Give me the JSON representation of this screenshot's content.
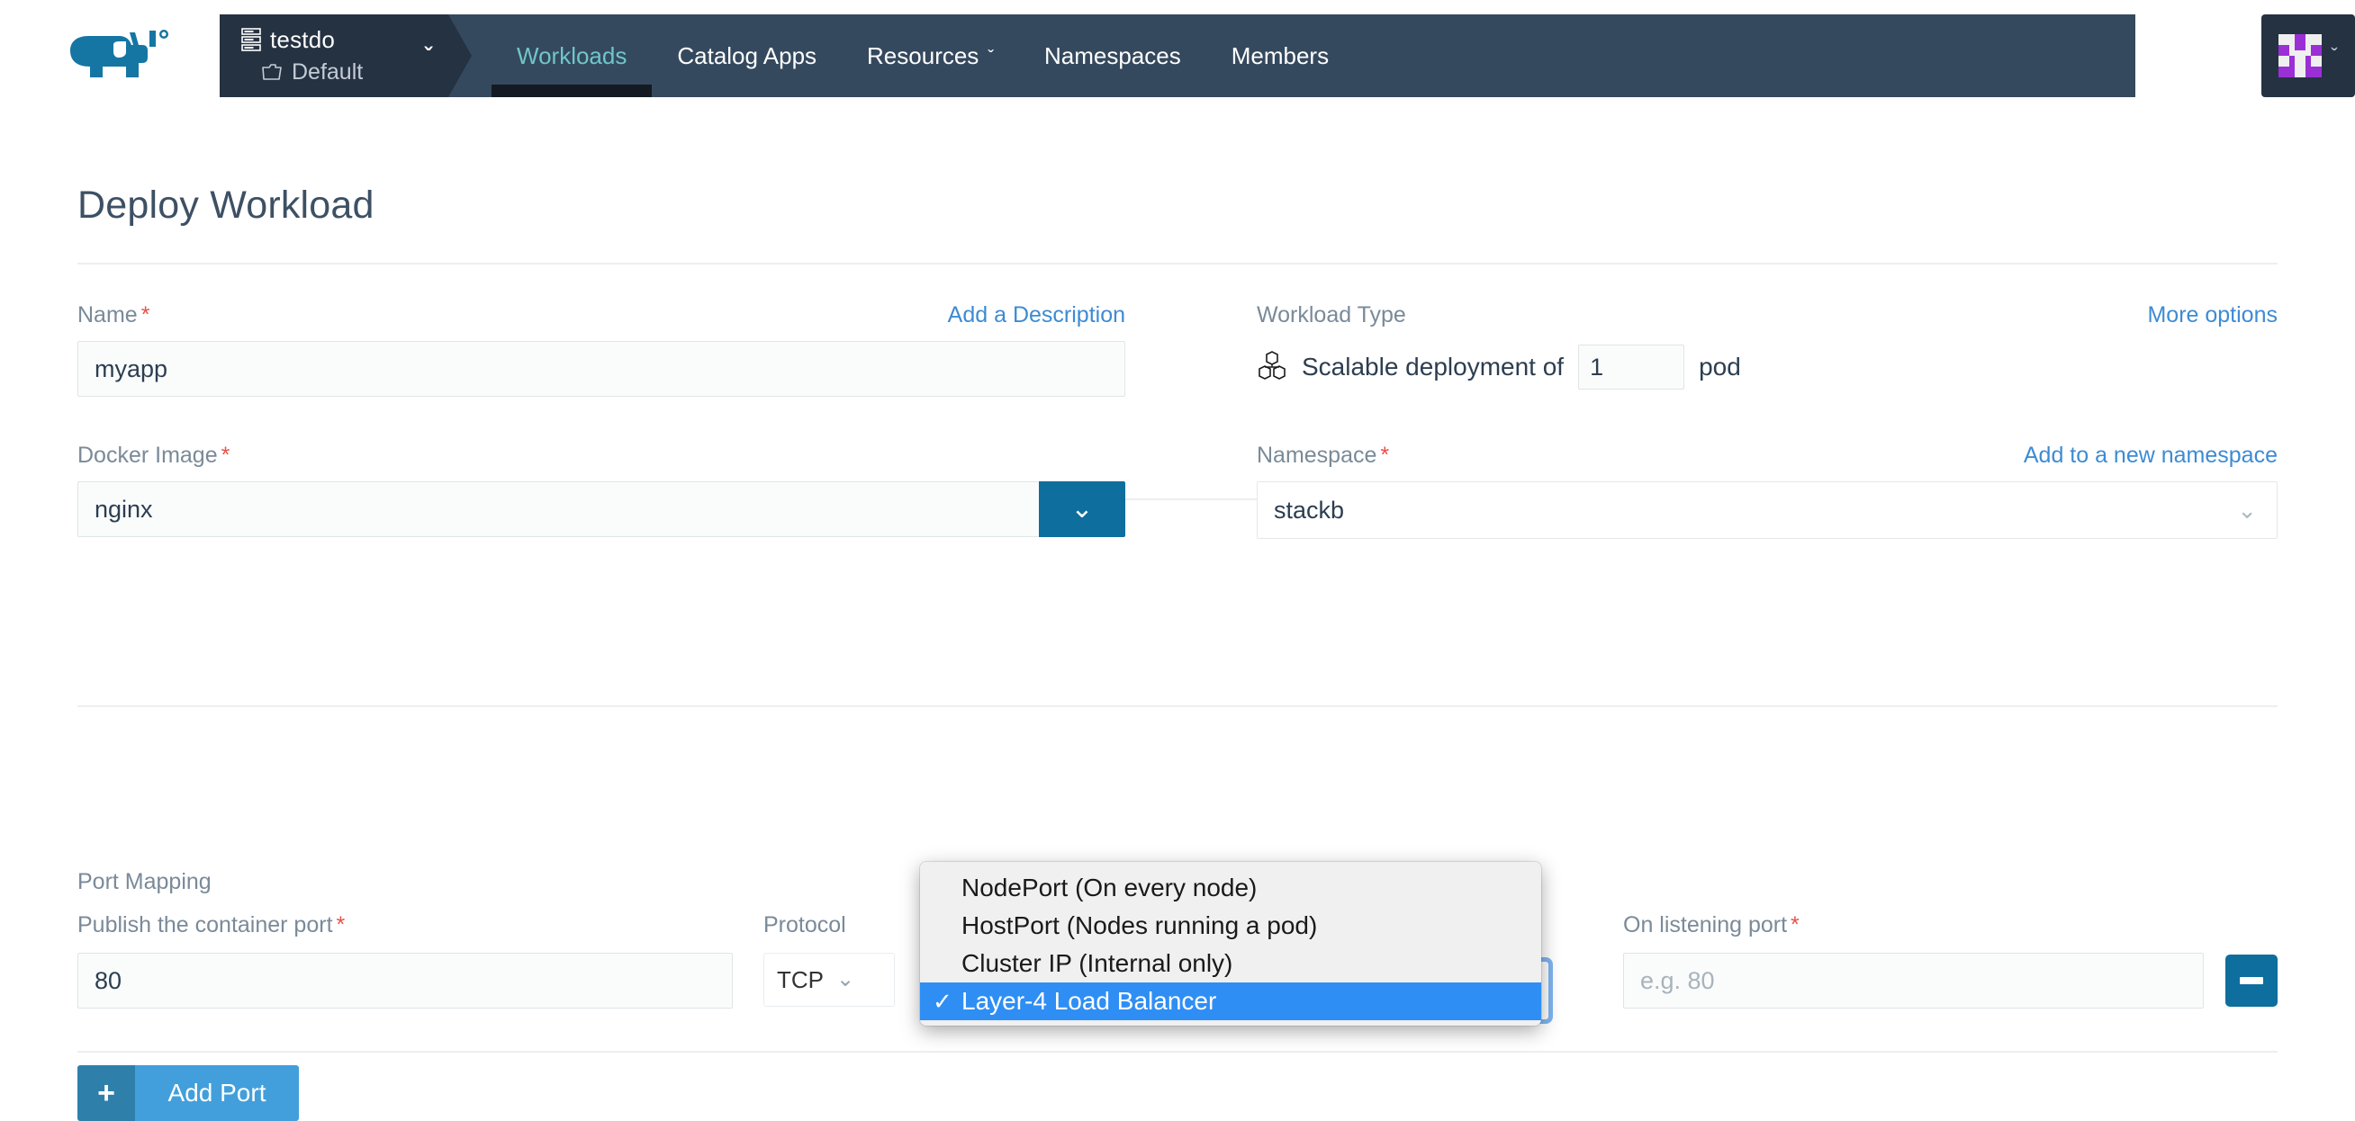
{
  "header": {
    "logo_name": "rancher-cow-logo",
    "cluster": {
      "name": "testdo",
      "project": "Default",
      "caret": "ˇ"
    },
    "nav": [
      {
        "label": "Workloads",
        "active": true,
        "caret": ""
      },
      {
        "label": "Catalog Apps",
        "active": false,
        "caret": ""
      },
      {
        "label": "Resources",
        "active": false,
        "caret": "ˇ"
      },
      {
        "label": "Namespaces",
        "active": false,
        "caret": ""
      },
      {
        "label": "Members",
        "active": false,
        "caret": ""
      }
    ],
    "user": {
      "caret": "ˇ"
    }
  },
  "page": {
    "title": "Deploy Workload"
  },
  "name": {
    "label": "Name",
    "required": "*",
    "link": "Add a Description",
    "value": "myapp",
    "placeholder": ""
  },
  "workload_type": {
    "label": "Workload Type",
    "link": "More options",
    "icon": "scalable-deployment-icon",
    "text_before": "Scalable deployment of",
    "scale_value": "1",
    "text_after": "pod"
  },
  "docker_image": {
    "label": "Docker Image",
    "required": "*",
    "value": "nginx",
    "placeholder": "",
    "dropdown_caret": "⌄"
  },
  "namespace": {
    "label": "Namespace",
    "required": "*",
    "link": "Add to a new namespace",
    "value": "stackb",
    "caret": "⌄"
  },
  "port_mapping": {
    "section_label": "Port Mapping",
    "publish": {
      "label": "Publish the container port",
      "required": "*",
      "value": "80",
      "placeholder": ""
    },
    "protocol": {
      "label": "Protocol",
      "value": "TCP",
      "caret": "⌄"
    },
    "type": {
      "label": "",
      "selected": "Layer-4 Load Balancer",
      "options": [
        {
          "label": "NodePort (On every node)",
          "selected": false
        },
        {
          "label": "HostPort (Nodes running a pod)",
          "selected": false
        },
        {
          "label": "Cluster IP (Internal only)",
          "selected": false
        },
        {
          "label": "Layer-4 Load Balancer",
          "selected": true
        }
      ],
      "check_glyph": "✓"
    },
    "listening": {
      "label": "On listening port",
      "required": "*",
      "value": "",
      "placeholder": "e.g. 80"
    },
    "remove_button_name": "remove-port-row",
    "add_button": {
      "icon": "+",
      "label": "Add Port"
    }
  },
  "colors": {
    "nav_bg": "#35495e",
    "picker_bg": "#253242",
    "active_nav": "#6fc6c9",
    "link": "#3d8bd4",
    "required": "#e8504a",
    "primary_blue": "#0e6e9e",
    "add_button": "#429fdb",
    "highlight": "#2f8ef4",
    "avatar": "#9b2fd6"
  }
}
